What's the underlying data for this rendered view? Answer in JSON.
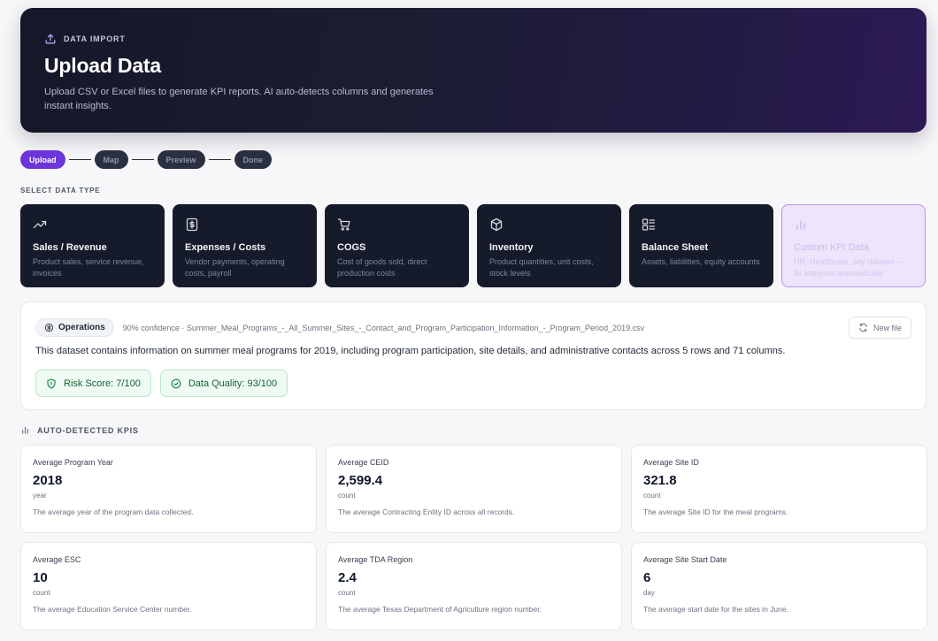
{
  "hero": {
    "tag": "DATA IMPORT",
    "title": "Upload Data",
    "description": "Upload CSV or Excel files to generate KPI reports. AI auto-detects columns and generates instant insights."
  },
  "steps": [
    {
      "label": "Upload",
      "active": true
    },
    {
      "label": "Map",
      "active": false
    },
    {
      "label": "Preview",
      "active": false
    },
    {
      "label": "Done",
      "active": false
    }
  ],
  "data_type_section": {
    "label": "SELECT DATA TYPE",
    "types": [
      {
        "icon": "trending-up-icon",
        "title": "Sales / Revenue",
        "description": "Product sales, service revenue, invoices"
      },
      {
        "icon": "dollar-icon",
        "title": "Expenses / Costs",
        "description": "Vendor payments, operating costs, payroll"
      },
      {
        "icon": "cart-icon",
        "title": "COGS",
        "description": "Cost of goods sold, direct production costs"
      },
      {
        "icon": "box-icon",
        "title": "Inventory",
        "description": "Product quantities, unit costs, stock levels"
      },
      {
        "icon": "list-icon",
        "title": "Balance Sheet",
        "description": "Assets, liabilities, equity accounts"
      },
      {
        "icon": "bar-chart-icon",
        "title": "Custom KPI Data",
        "description": "HR, Healthcare, any dataset — AI analyses automatically"
      }
    ]
  },
  "analysis": {
    "category": "Operations",
    "confidence_text": "90% confidence · Summer_Meal_Programs_-_All_Summer_Sites_-_Contact_and_Program_Participation_Information_-_Program_Period_2019.csv",
    "new_file_label": "New file",
    "summary": "This dataset contains information on summer meal programs for 2019, including program participation, site details, and administrative contacts across 5 rows and 71 columns.",
    "risk_score": "Risk Score: 7/100",
    "data_quality": "Data Quality: 93/100"
  },
  "kpis": {
    "header": "AUTO-DETECTED KPIS",
    "items": [
      {
        "label": "Average Program Year",
        "value": "2018",
        "unit": "year",
        "description": "The average year of the program data collected."
      },
      {
        "label": "Average CEID",
        "value": "2,599.4",
        "unit": "count",
        "description": "The average Contracting Entity ID across all records."
      },
      {
        "label": "Average Site ID",
        "value": "321.8",
        "unit": "count",
        "description": "The average Site ID for the meal programs."
      },
      {
        "label": "Average ESC",
        "value": "10",
        "unit": "count",
        "description": "The average Education Service Center number."
      },
      {
        "label": "Average TDA Region",
        "value": "2.4",
        "unit": "count",
        "description": "The average Texas Department of Agriculture region number."
      },
      {
        "label": "Average Site Start Date",
        "value": "6",
        "unit": "day",
        "description": "The average start date for the sites in June."
      }
    ]
  }
}
